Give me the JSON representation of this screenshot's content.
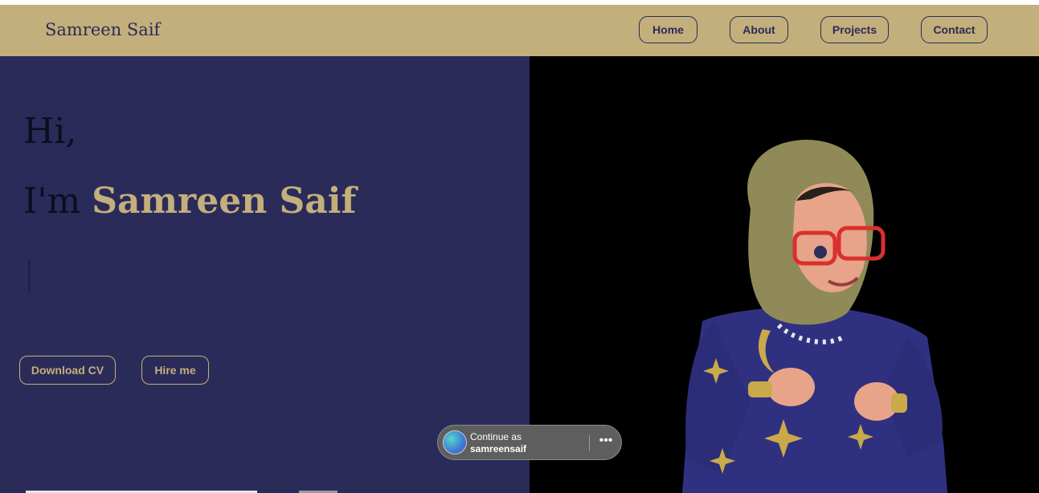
{
  "nav": {
    "brand": "Samreen Saif",
    "items": [
      {
        "label": "Home"
      },
      {
        "label": "About"
      },
      {
        "label": "Projects"
      },
      {
        "label": "Contact"
      }
    ]
  },
  "hero": {
    "greeting": "Hi,",
    "intro_prefix": "I'm",
    "name": "Samreen Saif",
    "buttons": {
      "download_cv": "Download CV",
      "hire_me": "Hire me"
    }
  },
  "login_prompt": {
    "line1": "Continue as",
    "username": "samreensaif",
    "more_icon": "more-horizontal-icon"
  },
  "colors": {
    "accent": "#c3af7b",
    "navy": "#2b2b5a",
    "dark": "#000000"
  }
}
